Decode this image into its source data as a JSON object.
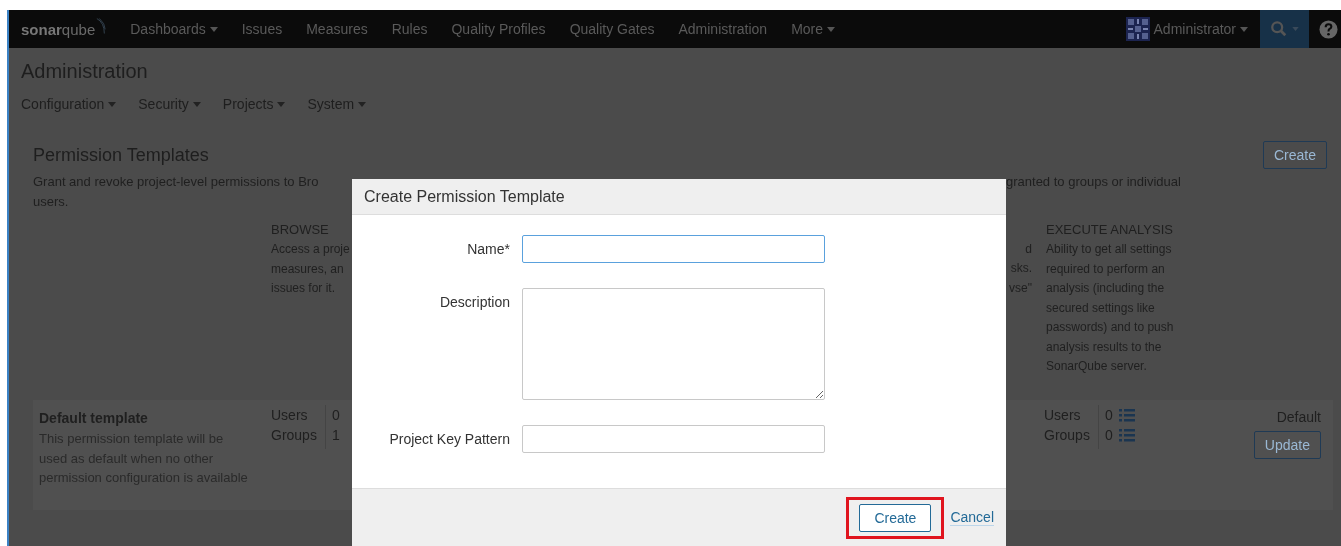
{
  "nav": {
    "logo": {
      "bold": "sonar",
      "light": "qube"
    },
    "items": [
      {
        "label": "Dashboards",
        "dropdown": true
      },
      {
        "label": "Issues",
        "dropdown": false
      },
      {
        "label": "Measures",
        "dropdown": false
      },
      {
        "label": "Rules",
        "dropdown": false
      },
      {
        "label": "Quality Profiles",
        "dropdown": false
      },
      {
        "label": "Quality Gates",
        "dropdown": false
      },
      {
        "label": "Administration",
        "dropdown": false
      },
      {
        "label": "More",
        "dropdown": true
      }
    ],
    "user": {
      "label": "Administrator",
      "dropdown": true
    }
  },
  "admin_header": {
    "title": "Administration",
    "menu": [
      {
        "label": "Configuration",
        "dropdown": true
      },
      {
        "label": "Security",
        "dropdown": true
      },
      {
        "label": "Projects",
        "dropdown": true
      },
      {
        "label": "System",
        "dropdown": true
      }
    ]
  },
  "permission_templates": {
    "title": "Permission Templates",
    "create_button": "Create",
    "description_left": [
      "Grant and revoke project-level permissions to Bro",
      "users."
    ],
    "description_right": [
      "granted to groups or individual"
    ],
    "browse": {
      "heading": "BROWSE",
      "lines": [
        "Access a proje",
        "measures, an",
        "issues for it."
      ]
    },
    "cut_column_lines": [
      "d",
      "sks.",
      "vse\""
    ],
    "execute_analysis": {
      "heading": "EXECUTE ANALYSIS",
      "lines": [
        "Ability to get all settings",
        "required to perform an",
        "analysis (including the",
        "secured settings like",
        "passwords) and to push",
        "analysis results to the",
        "SonarQube server."
      ]
    },
    "template": {
      "name": "Default template",
      "description": "This permission template will be used as default when no other permission configuration is available",
      "left_counts": [
        {
          "label": "Users",
          "count": "0"
        },
        {
          "label": "Groups",
          "count": "1"
        }
      ],
      "right_counts": [
        {
          "label": "Users",
          "count": "0"
        },
        {
          "label": "Groups",
          "count": "0"
        }
      ],
      "default_label": "Default",
      "update_button": "Update"
    }
  },
  "dialog": {
    "title": "Create Permission Template",
    "fields": [
      {
        "kind": "input",
        "label": "Name*",
        "focused": true
      },
      {
        "kind": "textarea",
        "label": "Description",
        "focused": false
      },
      {
        "kind": "input",
        "label": "Project Key Pattern",
        "focused": false
      }
    ],
    "submit": {
      "label": "Create",
      "highlighted": true
    },
    "cancel": "Cancel"
  }
}
